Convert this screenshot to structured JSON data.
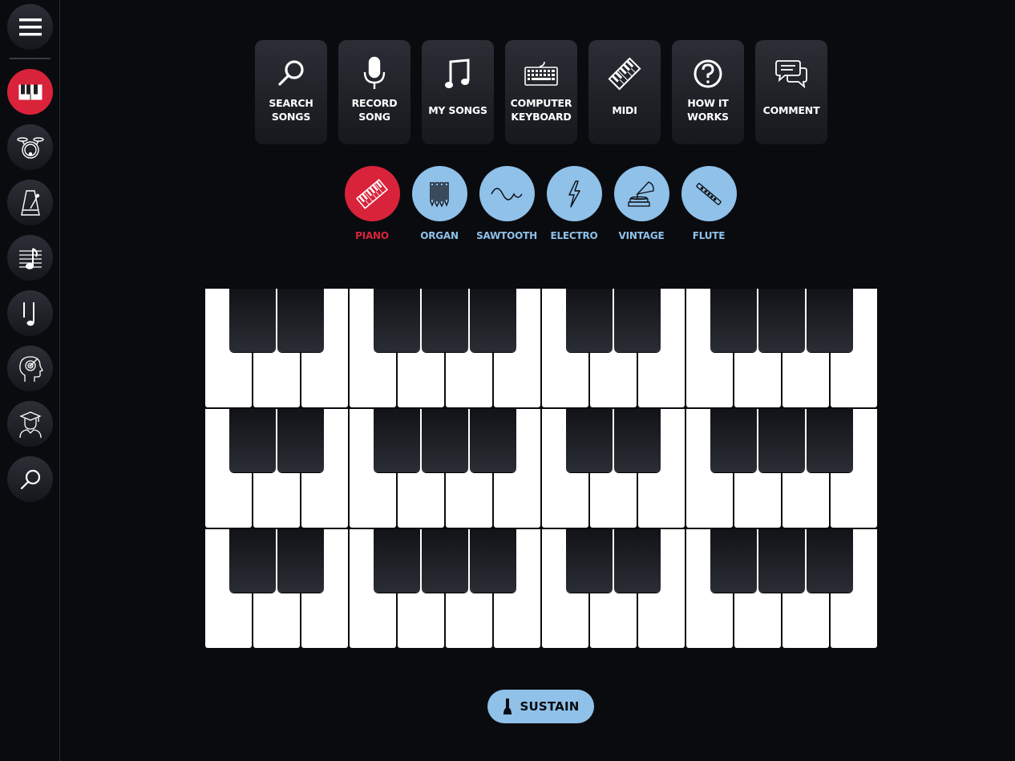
{
  "sidebar": {
    "items": [
      {
        "icon": "menu-icon"
      },
      {
        "icon": "piano-icon",
        "active": true
      },
      {
        "icon": "drums-icon"
      },
      {
        "icon": "metronome-icon"
      },
      {
        "icon": "sheet-music-icon"
      },
      {
        "icon": "music-note-icon"
      },
      {
        "icon": "ear-training-head-icon"
      },
      {
        "icon": "student-graduate-icon"
      },
      {
        "icon": "search-icon"
      }
    ]
  },
  "tools": [
    {
      "label": "SEARCH\nSONGS",
      "icon": "search-icon"
    },
    {
      "label": "RECORD\nSONG",
      "icon": "microphone-icon"
    },
    {
      "label": "MY SONGS",
      "icon": "music-note-icon"
    },
    {
      "label": "COMPUTER\nKEYBOARD",
      "icon": "keyboard-icon"
    },
    {
      "label": "MIDI",
      "icon": "midi-keys-icon"
    },
    {
      "label": "HOW IT\nWORKS",
      "icon": "question-icon"
    },
    {
      "label": "COMMENT",
      "icon": "chat-bubbles-icon"
    }
  ],
  "sounds": [
    {
      "label": "PIANO",
      "icon": "piano-icon",
      "active": true
    },
    {
      "label": "ORGAN",
      "icon": "organ-pipes-icon",
      "active": false
    },
    {
      "label": "SAWTOOTH",
      "icon": "wave-icon",
      "active": false
    },
    {
      "label": "ELECTRO",
      "icon": "lightning-icon",
      "active": false
    },
    {
      "label": "VINTAGE",
      "icon": "gramophone-icon",
      "active": false
    },
    {
      "label": "FLUTE",
      "icon": "flute-icon",
      "active": false
    }
  ],
  "keyboard": {
    "rows": 3,
    "octaves_per_row": 2,
    "white_keys_per_row": 14
  },
  "sustain": {
    "label": "SUSTAIN",
    "icon": "sustain-pedal-icon"
  },
  "colors": {
    "background": "#0a0b0f",
    "accent_red": "#d9233b",
    "accent_blue": "#8fc1e9",
    "white_key": "#ffffff"
  }
}
